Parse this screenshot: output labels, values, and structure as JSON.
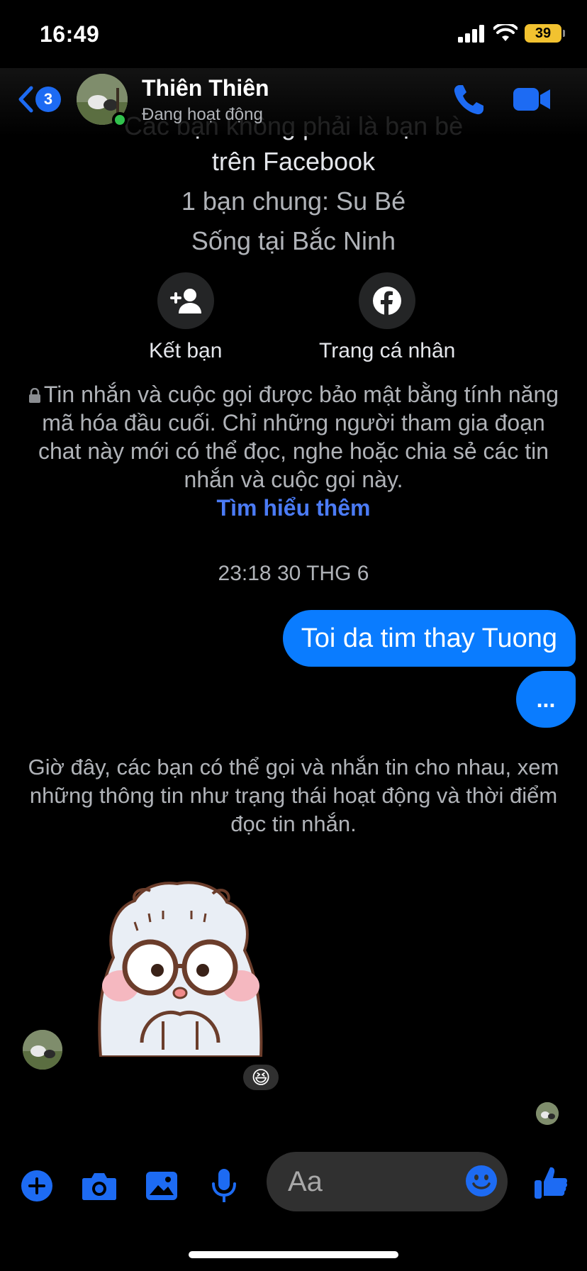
{
  "status_bar": {
    "time": "16:49",
    "battery": "39"
  },
  "header": {
    "back_count": "3",
    "name": "Thiên Thiên",
    "status": "Đang hoạt động",
    "icons": [
      "back-chevron-icon",
      "phone-icon",
      "video-camera-icon"
    ]
  },
  "intro": {
    "partial_line": "Các bạn không phải là bạn bè",
    "line1": "trên Facebook",
    "mutual": "1 bạn chung: Su Bé",
    "location": "Sống tại Bắc Ninh"
  },
  "actions": {
    "add_friend": "Kết bạn",
    "profile": "Trang cá nhân"
  },
  "encryption": {
    "text": "Tin nhắn và cuộc gọi được bảo mật bằng tính năng mã hóa đầu cuối. Chỉ những người tham gia đoạn chat này mới có thể đọc, nghe hoặc chia sẻ các tin nhắn và cuộc gọi này.",
    "link": "Tìm hiểu thêm"
  },
  "thread": {
    "timestamp": "23:18 30 THG 6",
    "outgoing_message": "Toi da tim thay Tuong",
    "outgoing_dots": "...",
    "system_message": "Giờ đây, các bạn có thể gọi và nhắn tin cho nhau, xem những thông tin như trạng thái hoạt động và thời điểm đọc tin nhắn.",
    "reaction": "😆"
  },
  "composer": {
    "placeholder": "Aa",
    "icons": [
      "plus-icon",
      "camera-icon",
      "gallery-icon",
      "microphone-icon",
      "emoji-icon",
      "thumbs-up-icon"
    ]
  },
  "colors": {
    "accent": "#0a7cff",
    "link": "#4b7bf5",
    "online": "#31c24d",
    "battery": "#f2c230"
  }
}
